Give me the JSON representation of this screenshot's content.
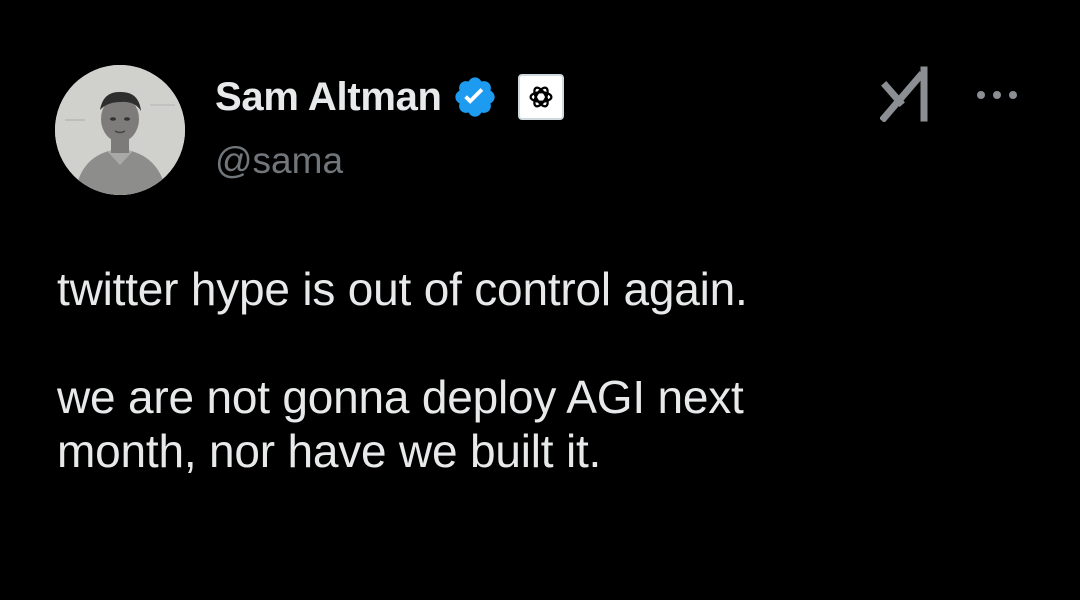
{
  "tweet": {
    "author": {
      "display_name": "Sam Altman",
      "handle": "@sama",
      "verified_badge_icon": "verified-checkmark-icon",
      "affiliate_badge_icon": "openai-logo-icon"
    },
    "grok_icon": "grok-icon",
    "more_icon": "more-options-icon",
    "text_paragraphs": [
      "twitter hype is out of control again.",
      "we are not gonna deploy AGI next\nmonth, nor have we built it."
    ]
  },
  "colors": {
    "background": "#000000",
    "primary_text": "#e7e9ea",
    "secondary_text": "#71767b",
    "verified_blue": "#1d9bf0"
  }
}
